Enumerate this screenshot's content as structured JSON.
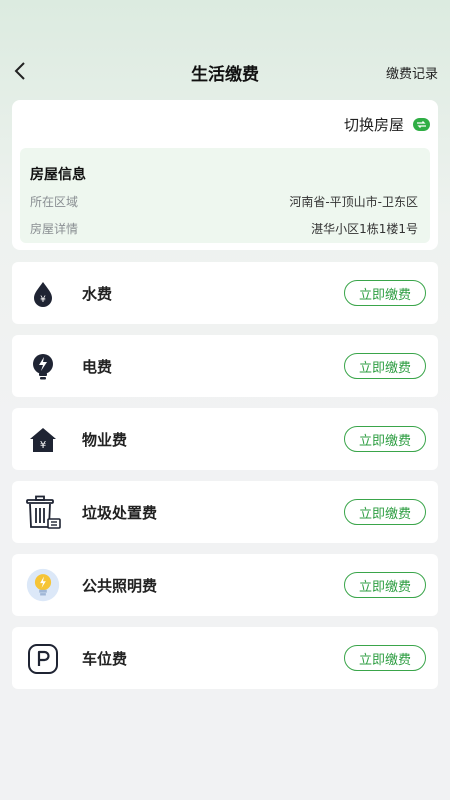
{
  "nav": {
    "title": "生活缴费",
    "records_label": "缴费记录"
  },
  "house": {
    "switch_label": "切换房屋",
    "info_title": "房屋信息",
    "area_label": "所在区域",
    "area_value": "河南省-平顶山市-卫东区",
    "detail_label": "房屋详情",
    "detail_value": "湛华小区1栋1楼1号"
  },
  "fees": [
    {
      "name": "水费",
      "button": "立即缴费",
      "icon": "water-drop-icon"
    },
    {
      "name": "电费",
      "button": "立即缴费",
      "icon": "lightning-bulb-icon"
    },
    {
      "name": "物业费",
      "button": "立即缴费",
      "icon": "house-yen-icon"
    },
    {
      "name": "垃圾处置费",
      "button": "立即缴费",
      "icon": "trash-bin-icon"
    },
    {
      "name": "公共照明费",
      "button": "立即缴费",
      "icon": "light-bulb-icon"
    },
    {
      "name": "车位费",
      "button": "立即缴费",
      "icon": "parking-icon"
    }
  ],
  "colors": {
    "accent": "#2e9e42",
    "icon_dark": "#1f2433",
    "info_bg": "#eef7ef"
  }
}
